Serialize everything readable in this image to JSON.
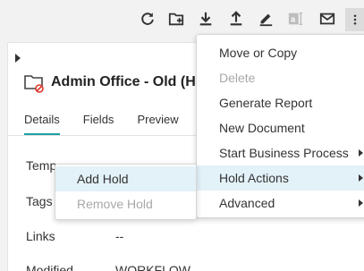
{
  "toolbar": {
    "icons": [
      "refresh-icon",
      "add-folder-icon",
      "download-icon",
      "upload-icon",
      "sign-icon",
      "text-field-icon",
      "mail-icon",
      "more-icon"
    ]
  },
  "document": {
    "title": "Admin Office - Old  (H"
  },
  "tabs": [
    {
      "label": "Details",
      "active": true
    },
    {
      "label": "Fields",
      "active": false
    },
    {
      "label": "Preview",
      "active": false
    }
  ],
  "fields": [
    {
      "label": "Temp",
      "value": ""
    },
    {
      "label": "Tags",
      "value": ""
    },
    {
      "label": "Links",
      "value": "--"
    },
    {
      "label": "Modified",
      "value": "WORKFLOW"
    }
  ],
  "main_menu": {
    "items": [
      {
        "label": "Move or Copy",
        "disabled": false
      },
      {
        "label": "Delete",
        "disabled": true
      },
      {
        "label": "Generate Report",
        "disabled": false
      },
      {
        "label": "New Document",
        "disabled": false
      },
      {
        "label": "Start Business Process",
        "disabled": false
      },
      {
        "label": "Hold Actions",
        "disabled": false
      },
      {
        "label": "Advanced",
        "disabled": false
      }
    ]
  },
  "submenu": {
    "items": [
      {
        "label": "Add Hold",
        "disabled": false
      },
      {
        "label": "Remove Hold",
        "disabled": true
      }
    ]
  },
  "colors": {
    "accent": "#1aa0a6",
    "highlight": "#e3f1f8",
    "disabled_text": "#a8a8a8",
    "badge_red": "#d9342b"
  }
}
